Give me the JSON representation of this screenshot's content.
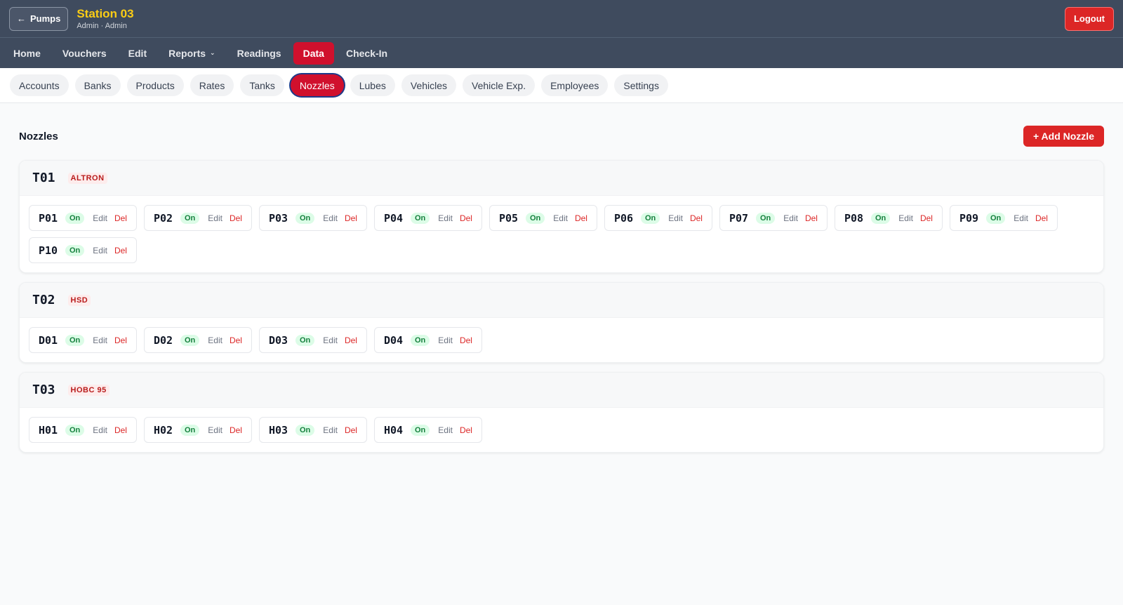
{
  "header": {
    "back_label": "Pumps",
    "station_name": "Station 03",
    "station_sub": "Admin · Admin",
    "logout_label": "Logout"
  },
  "main_nav": [
    {
      "label": "Home",
      "active": false
    },
    {
      "label": "Vouchers",
      "active": false
    },
    {
      "label": "Edit",
      "active": false
    },
    {
      "label": "Reports",
      "active": false,
      "dropdown": true
    },
    {
      "label": "Readings",
      "active": false
    },
    {
      "label": "Data",
      "active": true
    },
    {
      "label": "Check-In",
      "active": false
    }
  ],
  "sub_nav": [
    {
      "label": "Accounts",
      "active": false
    },
    {
      "label": "Banks",
      "active": false
    },
    {
      "label": "Products",
      "active": false
    },
    {
      "label": "Rates",
      "active": false
    },
    {
      "label": "Tanks",
      "active": false
    },
    {
      "label": "Nozzles",
      "active": true
    },
    {
      "label": "Lubes",
      "active": false
    },
    {
      "label": "Vehicles",
      "active": false
    },
    {
      "label": "Vehicle Exp.",
      "active": false
    },
    {
      "label": "Employees",
      "active": false
    },
    {
      "label": "Settings",
      "active": false
    }
  ],
  "page": {
    "title": "Nozzles",
    "add_label": "+ Add Nozzle"
  },
  "nozzle_actions": {
    "status": "On",
    "edit": "Edit",
    "del": "Del"
  },
  "tanks": [
    {
      "code": "T01",
      "product": "ALTRON",
      "nozzles": [
        "P01",
        "P02",
        "P03",
        "P04",
        "P05",
        "P06",
        "P07",
        "P08",
        "P09",
        "P10"
      ]
    },
    {
      "code": "T02",
      "product": "HSD",
      "nozzles": [
        "D01",
        "D02",
        "D03",
        "D04"
      ]
    },
    {
      "code": "T03",
      "product": "HOBC 95",
      "nozzles": [
        "H01",
        "H02",
        "H03",
        "H04"
      ]
    }
  ],
  "colors": {
    "topbar": "#3f4b5e",
    "accent": "#d0102d",
    "title_yellow": "#facc15",
    "on_green": "#15803d"
  }
}
